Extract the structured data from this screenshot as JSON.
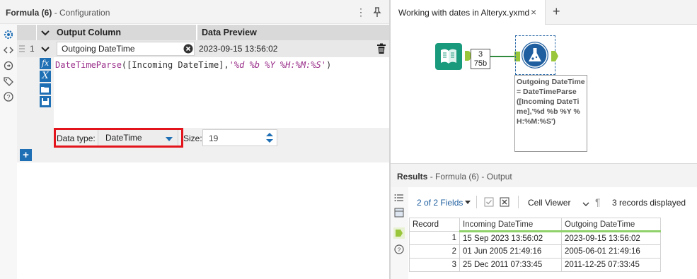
{
  "config": {
    "title": "Formula (6)",
    "subtitle": "- Configuration",
    "columns": {
      "output": "Output Column",
      "preview": "Data Preview"
    },
    "row": {
      "number": "1",
      "output_column": "Outgoing DateTime",
      "preview": "2023-09-15 13:56:02"
    },
    "expression": {
      "fn": "DateTimeParse",
      "open": "(",
      "field": "[Incoming DateTime]",
      "comma": ",",
      "format": "'%d %b %Y %H:%M:%S'",
      "close": ")"
    },
    "data_type_label": "Data type:",
    "data_type_value": "DateTime",
    "size_label": "Size:",
    "size_value": "19",
    "add_label": "+"
  },
  "workflow_tab": {
    "label": "Working with dates in Alteryx.yxmd",
    "close": "×",
    "add": "+"
  },
  "canvas": {
    "record_count": "3",
    "record_size": "75b",
    "annotation": "Outgoing DateTime = DateTimeParse ([Incoming DateTime],'%d %b %Y %H:%M:%S')"
  },
  "results": {
    "title": "Results",
    "subtitle": "- Formula (6) - Output",
    "fields_btn": "2 of 2 Fields",
    "cell_viewer": "Cell Viewer",
    "records_displayed": "3 records displayed",
    "headers": [
      "Record",
      "Incoming DateTime",
      "Outgoing DateTime"
    ],
    "rows": [
      [
        "1",
        "15 Sep 2023 13:56:02",
        "2023-09-15 13:56:02"
      ],
      [
        "2",
        "01 Jun 2005 21:49:16",
        "2005-06-01 21:49:16"
      ],
      [
        "3",
        "25 Dec 2011 07:33:45",
        "2011-12-25 07:33:45"
      ]
    ]
  },
  "colors": {
    "accent": "#1f6fb5",
    "highlight": "#e3141b",
    "anchor": "#9ac63c",
    "input_tool": "#1a9a7c"
  },
  "icons": [
    "gear-icon",
    "code-icon",
    "connection-icon",
    "tag-icon",
    "help-icon",
    "more-icon",
    "pin-icon",
    "clear-icon",
    "trash-icon",
    "fx-icon",
    "variable-icon",
    "open-icon",
    "save-icon",
    "book-icon",
    "flask-icon",
    "list-icon",
    "table-icon",
    "anchor-icon",
    "check-icon",
    "xbox-icon",
    "pilcrow-icon"
  ]
}
